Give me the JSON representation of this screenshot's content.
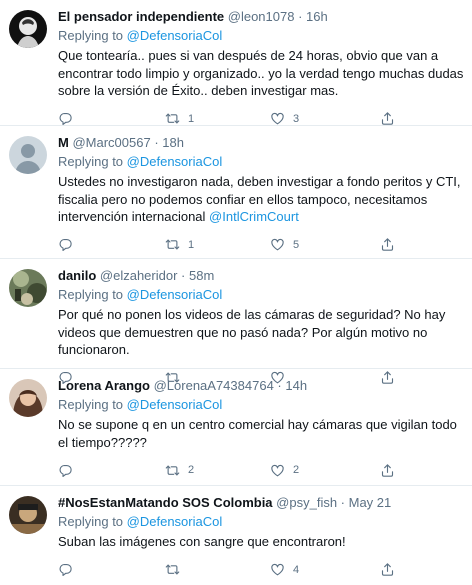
{
  "reply_prefix": "Replying to",
  "tweets": [
    {
      "name": "El pensador independiente",
      "handle": "@leon1078",
      "time": "16h",
      "replying_to": "@DefensoriaCol",
      "text": "Que tontearía.. pues si van después de 24 horas, obvio que van a encontrar todo limpio y organizado.. yo la verdad tengo muchas dudas sobre la versión de Éxito.. deben investigar mas.",
      "text_mention": "",
      "replies": "",
      "retweets": "1",
      "likes": "3"
    },
    {
      "name": "M",
      "handle": "@Marc00567",
      "time": "18h",
      "replying_to": "@DefensoriaCol",
      "text": "Ustedes no investigaron nada, deben investigar a fondo peritos y CTI, fiscalia pero no podemos confiar en ellos tampoco, necesitamos intervención internacional ",
      "text_mention": "@IntlCrimCourt",
      "replies": "",
      "retweets": "1",
      "likes": "5"
    },
    {
      "name": "danilo",
      "handle": "@elzaheridor",
      "time": "58m",
      "replying_to": "@DefensoriaCol",
      "text": "Por qué no ponen los videos de las cámaras de seguridad? No hay videos que demuestren que no pasó nada? Por algún motivo no funcionaron.",
      "text_mention": "",
      "replies": "",
      "retweets": "",
      "likes": ""
    },
    {
      "name": "Lorena Arango",
      "handle": "@LorenaA74384764",
      "time": "14h",
      "replying_to": "@DefensoriaCol",
      "text": "No se supone q en un centro comercial hay cámaras que vigilan todo el tiempo?????",
      "text_mention": "",
      "replies": "",
      "retweets": "2",
      "likes": "2"
    },
    {
      "name": "#NosEstanMatando SOS Colombia",
      "handle": "@psy_fish",
      "time": "May 21",
      "replying_to": "@DefensoriaCol",
      "text": "Suban las imágenes con sangre que encontraron!",
      "text_mention": "",
      "replies": "",
      "retweets": "",
      "likes": "4"
    }
  ],
  "colors": {
    "link": "#1b95e0",
    "muted": "#5b7083",
    "text": "#0f1419",
    "divider": "#e6ecf0"
  },
  "icons": [
    "reply-icon",
    "retweet-icon",
    "like-icon",
    "share-icon"
  ]
}
